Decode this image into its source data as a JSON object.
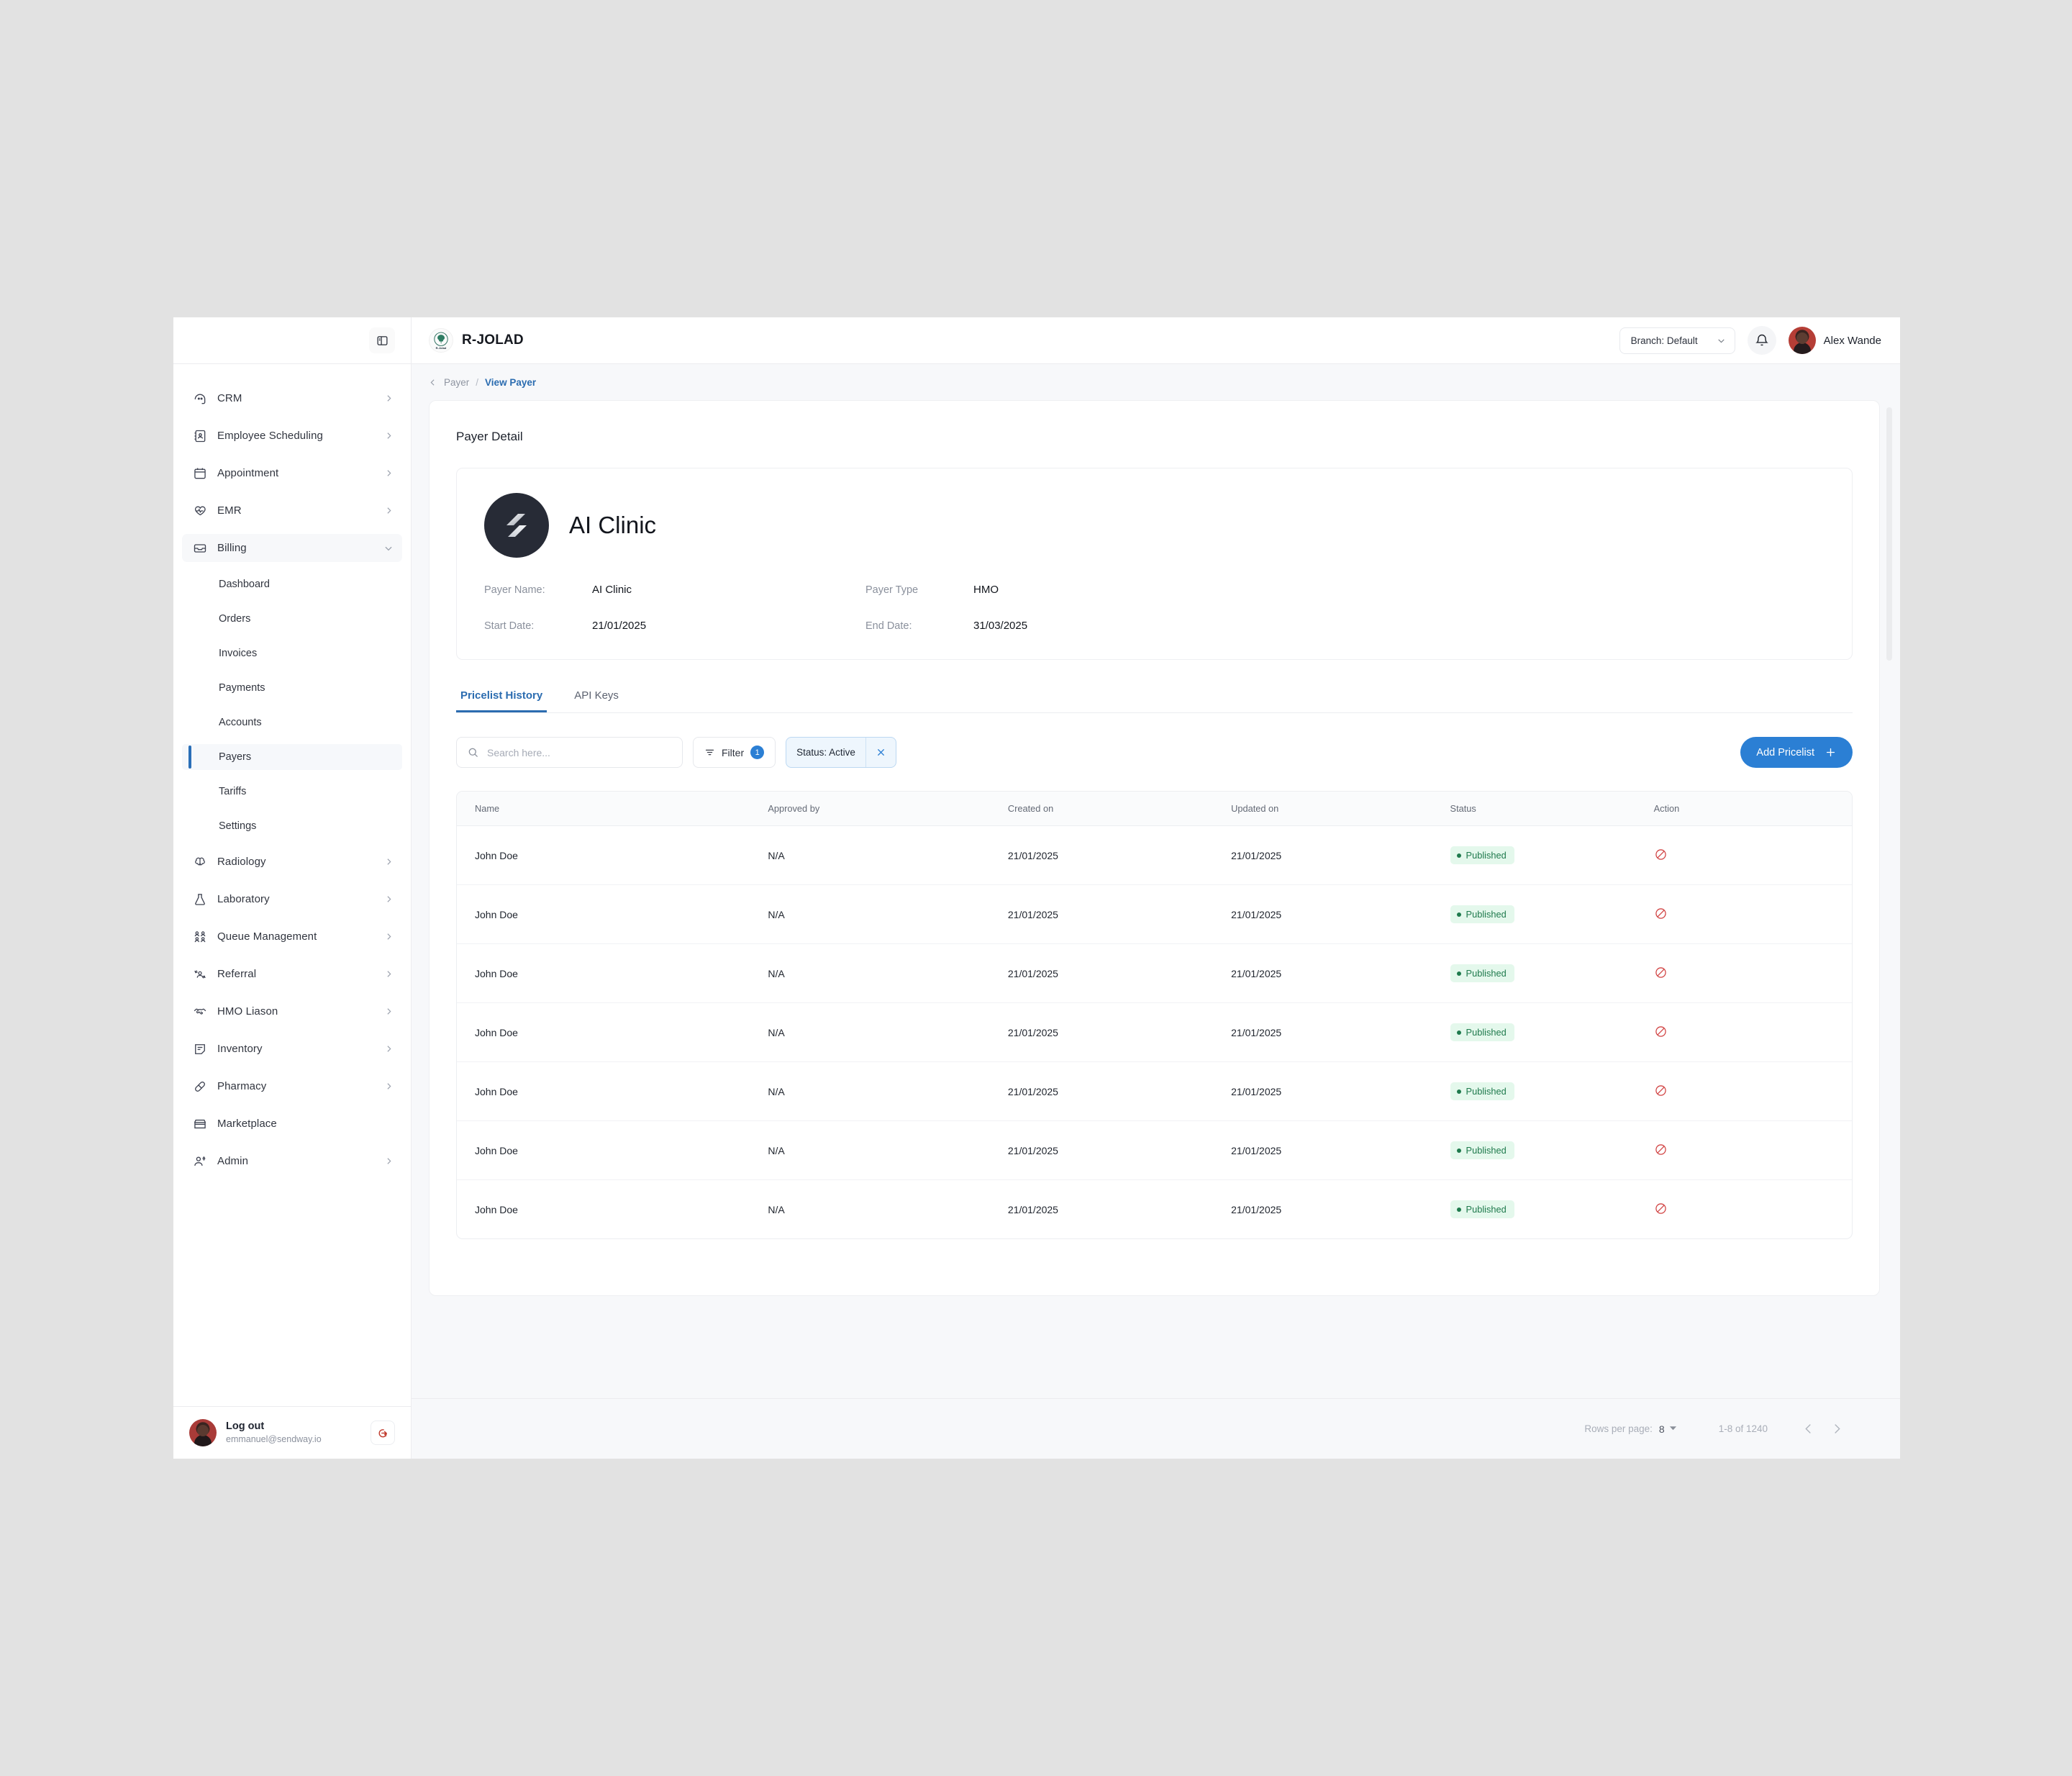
{
  "brand": {
    "name": "R-JOLAD",
    "logo_icon": "tree-logo"
  },
  "topbar": {
    "branch_label": "Branch: Default",
    "branch_caret_icon": "chevron-down-icon",
    "bell_icon": "bell-icon",
    "user_name": "Alex Wande",
    "panel_toggle_icon": "sidebar-panel-icon"
  },
  "breadcrumb": {
    "back_icon": "chevron-left-icon",
    "parent": "Payer",
    "separator": "/",
    "current": "View Payer"
  },
  "sidebar": {
    "items": [
      {
        "label": "CRM",
        "icon": "crm-icon",
        "chevron": "chevron-right-icon"
      },
      {
        "label": "Employee Scheduling",
        "icon": "contact-book-icon",
        "chevron": "chevron-right-icon"
      },
      {
        "label": "Appointment",
        "icon": "calendar-icon",
        "chevron": "chevron-right-icon"
      },
      {
        "label": "EMR",
        "icon": "heart-pulse-icon",
        "chevron": "chevron-right-icon"
      },
      {
        "label": "Billing",
        "icon": "billing-inbox-icon",
        "chevron": "chevron-down-icon",
        "expanded": true
      }
    ],
    "billing_children": [
      {
        "label": "Dashboard"
      },
      {
        "label": "Orders"
      },
      {
        "label": "Invoices"
      },
      {
        "label": "Payments"
      },
      {
        "label": "Accounts"
      },
      {
        "label": "Payers",
        "selected": true
      },
      {
        "label": "Tariffs"
      },
      {
        "label": "Settings"
      }
    ],
    "items_after": [
      {
        "label": "Radiology",
        "icon": "brain-icon",
        "chevron": "chevron-right-icon"
      },
      {
        "label": "Laboratory",
        "icon": "flask-icon",
        "chevron": "chevron-right-icon"
      },
      {
        "label": "Queue Management",
        "icon": "people-grid-icon",
        "chevron": "chevron-right-icon"
      },
      {
        "label": "Referral",
        "icon": "referral-user-icon",
        "chevron": "chevron-right-icon"
      },
      {
        "label": "HMO Liason",
        "icon": "handshake-icon",
        "chevron": "chevron-right-icon"
      },
      {
        "label": "Inventory",
        "icon": "document-list-icon",
        "chevron": "chevron-right-icon"
      },
      {
        "label": "Pharmacy",
        "icon": "pill-icon",
        "chevron": "chevron-right-icon"
      },
      {
        "label": "Marketplace",
        "icon": "store-icon",
        "chevron": ""
      },
      {
        "label": "Admin",
        "icon": "user-settings-icon",
        "chevron": "chevron-right-icon"
      }
    ],
    "footer": {
      "title": "Log out",
      "email": "emmanuel@sendway.io",
      "logout_icon": "logout-icon",
      "avatar_icon": "avatar"
    }
  },
  "page": {
    "title": "Payer Detail",
    "payer": {
      "display_name": "AI Clinic",
      "logo_icon": "payer-logo",
      "fields": [
        {
          "label": "Payer Name:",
          "value": "AI Clinic"
        },
        {
          "label": "Payer Type",
          "value": "HMO"
        },
        {
          "label": "Start Date:",
          "value": "21/01/2025"
        },
        {
          "label": "End Date:",
          "value": "31/03/2025"
        }
      ]
    },
    "tabs": [
      {
        "label": "Pricelist History",
        "active": true
      },
      {
        "label": "API Keys",
        "active": false
      }
    ],
    "toolbar": {
      "search_placeholder": "Search here...",
      "search_value": "",
      "search_icon": "search-icon",
      "filter_label": "Filter",
      "filter_icon": "filter-icon",
      "filter_count": "1",
      "chip_label": "Status: Active",
      "chip_close_icon": "close-icon",
      "add_label": "Add Pricelist",
      "add_icon": "plus-icon"
    },
    "table": {
      "columns": [
        "Name",
        "Approved by",
        "Created on",
        "Updated on",
        "Status",
        "Action"
      ],
      "rows": [
        {
          "name": "John Doe",
          "approved_by": "N/A",
          "created_on": "21/01/2025",
          "updated_on": "21/01/2025",
          "status": "Published",
          "action_icon": "block-icon"
        },
        {
          "name": "John Doe",
          "approved_by": "N/A",
          "created_on": "21/01/2025",
          "updated_on": "21/01/2025",
          "status": "Published",
          "action_icon": "block-icon"
        },
        {
          "name": "John Doe",
          "approved_by": "N/A",
          "created_on": "21/01/2025",
          "updated_on": "21/01/2025",
          "status": "Published",
          "action_icon": "block-icon"
        },
        {
          "name": "John Doe",
          "approved_by": "N/A",
          "created_on": "21/01/2025",
          "updated_on": "21/01/2025",
          "status": "Published",
          "action_icon": "block-icon"
        },
        {
          "name": "John Doe",
          "approved_by": "N/A",
          "created_on": "21/01/2025",
          "updated_on": "21/01/2025",
          "status": "Published",
          "action_icon": "block-icon"
        },
        {
          "name": "John Doe",
          "approved_by": "N/A",
          "created_on": "21/01/2025",
          "updated_on": "21/01/2025",
          "status": "Published",
          "action_icon": "block-icon"
        },
        {
          "name": "John Doe",
          "approved_by": "N/A",
          "created_on": "21/01/2025",
          "updated_on": "21/01/2025",
          "status": "Published",
          "action_icon": "block-icon"
        }
      ]
    },
    "pagination": {
      "rows_per_page_label": "Rows per page:",
      "rows_per_page_value": "8",
      "caret_icon": "caret-down-icon",
      "range": "1-8 of 1240",
      "prev_icon": "chevron-left-icon",
      "next_icon": "chevron-right-icon"
    }
  },
  "colors": {
    "accent": "#2b7fd4",
    "link": "#2b6cb0",
    "status_published_bg": "#e4f8ec",
    "status_published_fg": "#1f7a4d",
    "danger": "#d14343",
    "page_bg": "#e2e2e2"
  }
}
